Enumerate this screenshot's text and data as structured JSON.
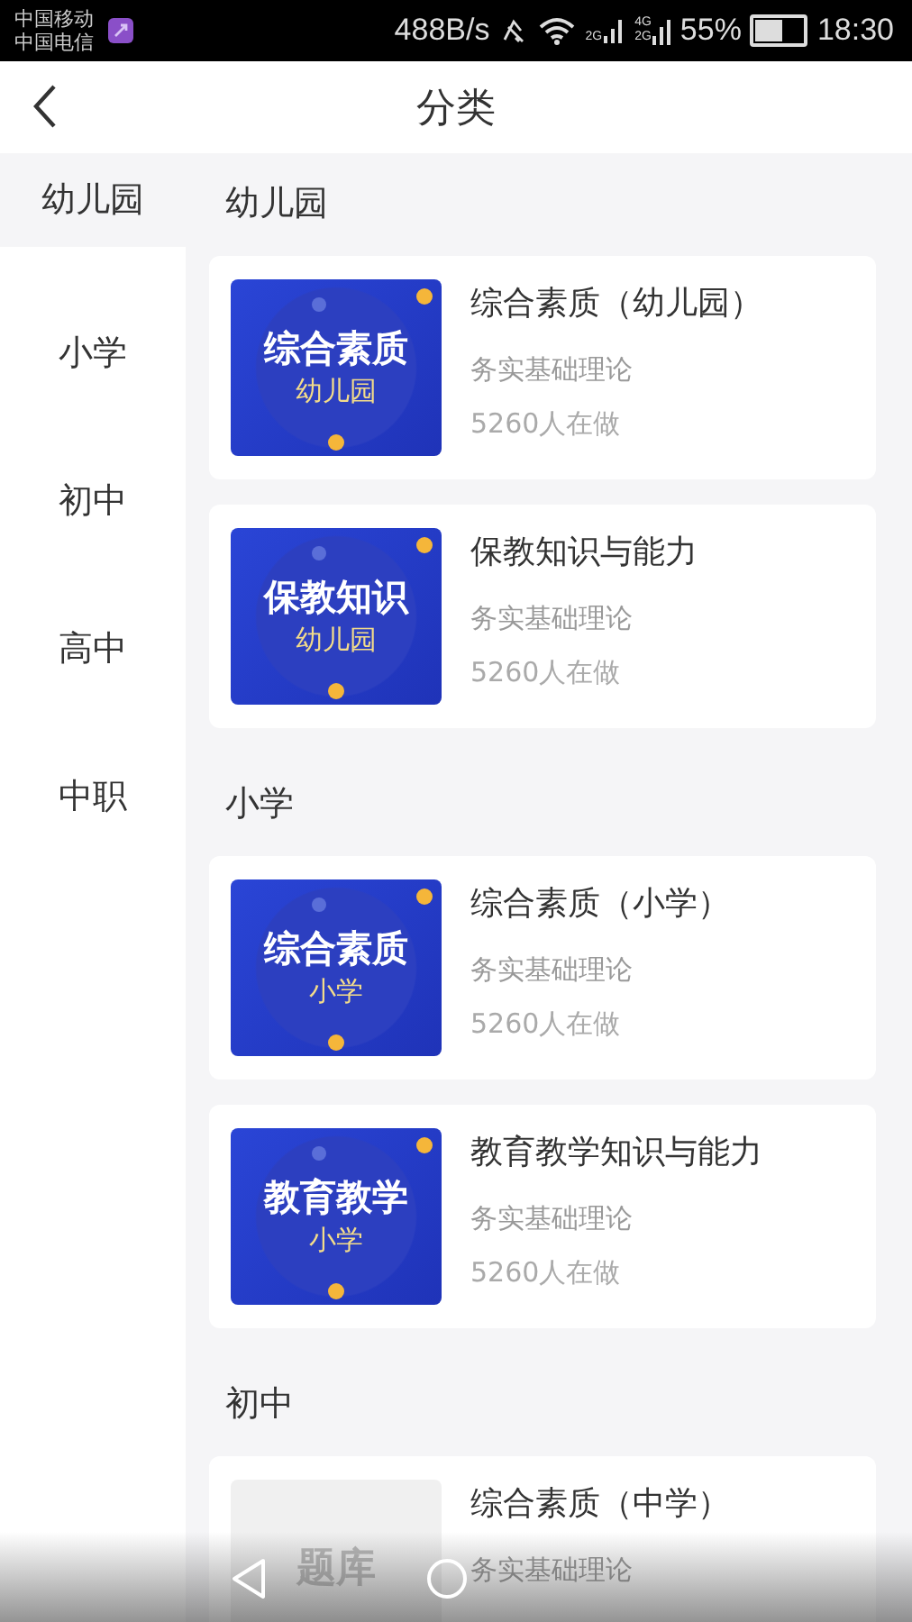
{
  "status_bar": {
    "carriers": [
      "中国移动",
      "中国电信"
    ],
    "speed": "488B/s",
    "signal_labels": [
      "2G",
      "4G",
      "2G"
    ],
    "battery": "55%",
    "time": "18:30"
  },
  "header": {
    "title": "分类"
  },
  "sidebar": {
    "items": [
      {
        "label": "幼儿园",
        "selected": true
      },
      {
        "label": "小学",
        "selected": false
      },
      {
        "label": "初中",
        "selected": false
      },
      {
        "label": "高中",
        "selected": false
      },
      {
        "label": "中职",
        "selected": false
      }
    ]
  },
  "sections": [
    {
      "title": "幼儿园",
      "courses": [
        {
          "thumb": {
            "kind": "cover",
            "title": "综合素质",
            "subtitle": "幼儿园"
          },
          "name": "综合素质（幼儿园）",
          "subtitle": "务实基础理论",
          "count": "5260人在做"
        },
        {
          "thumb": {
            "kind": "cover",
            "title": "保教知识",
            "subtitle": "幼儿园"
          },
          "name": "保教知识与能力",
          "subtitle": "务实基础理论",
          "count": "5260人在做"
        }
      ]
    },
    {
      "title": "小学",
      "courses": [
        {
          "thumb": {
            "kind": "cover",
            "title": "综合素质",
            "subtitle": "小学"
          },
          "name": "综合素质（小学）",
          "subtitle": "务实基础理论",
          "count": "5260人在做"
        },
        {
          "thumb": {
            "kind": "cover",
            "title": "教育教学",
            "subtitle": "小学"
          },
          "name": "教育教学知识与能力",
          "subtitle": "务实基础理论",
          "count": "5260人在做"
        }
      ]
    },
    {
      "title": "初中",
      "courses": [
        {
          "thumb": {
            "kind": "placeholder",
            "title": "题库"
          },
          "name": "综合素质（中学）",
          "subtitle": "务实基础理论"
        }
      ]
    }
  ]
}
